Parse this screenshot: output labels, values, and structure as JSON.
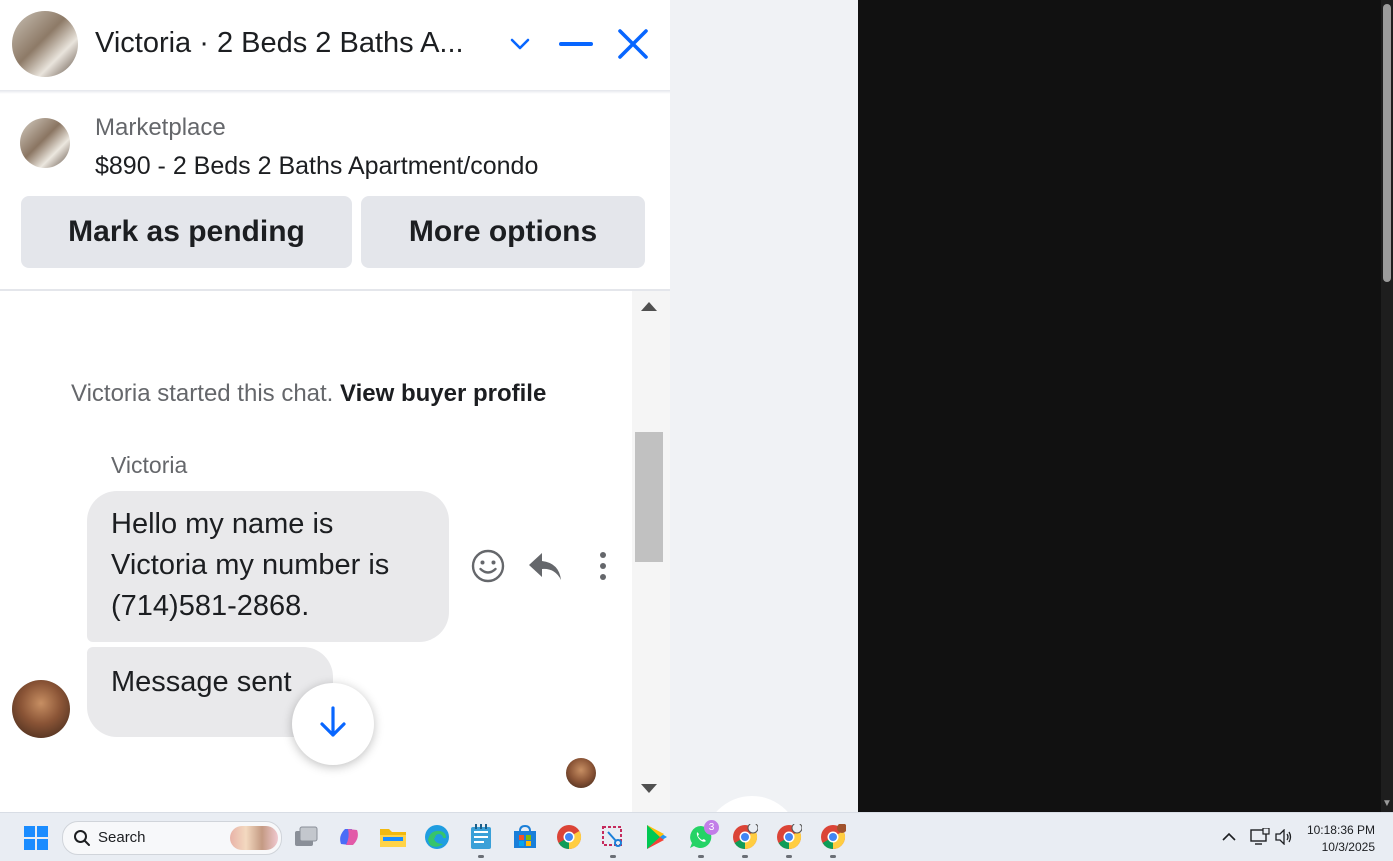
{
  "chat": {
    "title": "Victoria · 2 Beds 2 Baths A...",
    "listing_label": "Marketplace",
    "listing_title": "$890 - 2 Beds 2 Baths Apartment/condo",
    "mark_pending_label": "Mark as pending",
    "more_options_label": "More options",
    "started_text": "Victoria started this chat.",
    "view_profile_label": "View buyer profile",
    "sender_name": "Victoria",
    "messages": [
      {
        "text": "Hello my name is Victoria my number is (714)581-2868."
      },
      {
        "text": "Message sent"
      }
    ],
    "icons": {
      "expand": "chevron-down-icon",
      "minimize": "minimize-icon",
      "close": "close-icon",
      "react": "smiley-icon",
      "reply": "reply-icon",
      "more": "more-vertical-icon",
      "jump": "arrow-down-icon"
    },
    "accent_color": "#0866ff"
  },
  "taskbar": {
    "search_placeholder": "Search",
    "whatsapp_badge": "3",
    "time": "10:18:36 PM",
    "date": "10/3/2025",
    "apps": [
      "windows-start-icon",
      "task-view-icon",
      "copilot-icon",
      "file-explorer-icon",
      "edge-icon",
      "notepad-icon",
      "store-icon",
      "chrome-icon",
      "snipping-tool-icon",
      "play-store-icon",
      "whatsapp-icon",
      "chrome-profile-icon",
      "chrome-profile-icon",
      "chrome-profile-icon"
    ]
  }
}
